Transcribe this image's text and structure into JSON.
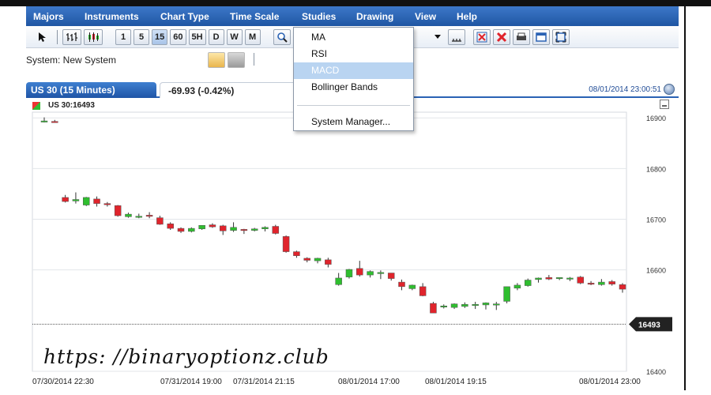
{
  "menu": {
    "items": [
      "Majors",
      "Instruments",
      "Chart Type",
      "Time Scale",
      "Studies",
      "Drawing",
      "View",
      "Help"
    ]
  },
  "toolbar": {
    "intervals": [
      "1",
      "5",
      "15",
      "60",
      "5H",
      "D",
      "W",
      "M"
    ],
    "active_interval": "15"
  },
  "system": {
    "label": "System:  New System"
  },
  "chart_tab": {
    "title": "US 30 (15 Minutes)",
    "change": "-69.93 (-0.42%)",
    "timestamp": "08/01/2014 23:00:51"
  },
  "legend": {
    "label": "US 30:16493"
  },
  "studies_menu": {
    "items": [
      "MA",
      "RSI",
      "MACD",
      "Bollinger Bands"
    ],
    "highlighted": "MACD",
    "footer": "System Manager..."
  },
  "watermark": "https:  //binaryoptionz.club",
  "colors": {
    "bull": "#2fbe2f",
    "bear": "#e0242c",
    "menubar": "#2a62b4",
    "highlight": "#b9d4f1"
  },
  "chart_data": {
    "type": "candlestick",
    "price_labels": [
      "16900",
      "16800",
      "16700",
      "16600",
      "16400"
    ],
    "price_values": [
      16900,
      16800,
      16700,
      16600,
      16400
    ],
    "current_price_label": "16493",
    "current_price": 16493,
    "x_labels": [
      "07/30/2014 22:30",
      "07/31/2014 19:00",
      "07/31/2014 21:15",
      "08/01/2014 17:00",
      "08/01/2014 19:15",
      "08/01/2014 23:00"
    ],
    "ylim": [
      16400,
      16905
    ],
    "candles": [
      {
        "o": 16893,
        "h": 16901,
        "l": 16891,
        "c": 16894
      },
      {
        "o": 16893,
        "h": 16896,
        "l": 16891,
        "c": 16892
      },
      {
        "o": 16743,
        "h": 16748,
        "l": 16733,
        "c": 16735
      },
      {
        "o": 16736,
        "h": 16753,
        "l": 16731,
        "c": 16739
      },
      {
        "o": 16728,
        "h": 16744,
        "l": 16726,
        "c": 16743
      },
      {
        "o": 16740,
        "h": 16745,
        "l": 16725,
        "c": 16731
      },
      {
        "o": 16731,
        "h": 16734,
        "l": 16725,
        "c": 16729
      },
      {
        "o": 16727,
        "h": 16728,
        "l": 16705,
        "c": 16707
      },
      {
        "o": 16705,
        "h": 16713,
        "l": 16703,
        "c": 16710
      },
      {
        "o": 16704,
        "h": 16711,
        "l": 16702,
        "c": 16706
      },
      {
        "o": 16708,
        "h": 16714,
        "l": 16702,
        "c": 16706
      },
      {
        "o": 16703,
        "h": 16707,
        "l": 16689,
        "c": 16690
      },
      {
        "o": 16691,
        "h": 16694,
        "l": 16679,
        "c": 16682
      },
      {
        "o": 16682,
        "h": 16684,
        "l": 16673,
        "c": 16676
      },
      {
        "o": 16676,
        "h": 16684,
        "l": 16674,
        "c": 16682
      },
      {
        "o": 16681,
        "h": 16688,
        "l": 16679,
        "c": 16688
      },
      {
        "o": 16689,
        "h": 16692,
        "l": 16683,
        "c": 16685
      },
      {
        "o": 16687,
        "h": 16689,
        "l": 16669,
        "c": 16677
      },
      {
        "o": 16678,
        "h": 16694,
        "l": 16675,
        "c": 16684
      },
      {
        "o": 16680,
        "h": 16681,
        "l": 16671,
        "c": 16679
      },
      {
        "o": 16678,
        "h": 16683,
        "l": 16676,
        "c": 16681
      },
      {
        "o": 16681,
        "h": 16686,
        "l": 16676,
        "c": 16684
      },
      {
        "o": 16686,
        "h": 16689,
        "l": 16670,
        "c": 16672
      },
      {
        "o": 16666,
        "h": 16668,
        "l": 16634,
        "c": 16636
      },
      {
        "o": 16636,
        "h": 16638,
        "l": 16624,
        "c": 16628
      },
      {
        "o": 16623,
        "h": 16625,
        "l": 16615,
        "c": 16619
      },
      {
        "o": 16618,
        "h": 16624,
        "l": 16613,
        "c": 16623
      },
      {
        "o": 16620,
        "h": 16624,
        "l": 16605,
        "c": 16611
      },
      {
        "o": 16571,
        "h": 16594,
        "l": 16569,
        "c": 16584
      },
      {
        "o": 16586,
        "h": 16602,
        "l": 16583,
        "c": 16601
      },
      {
        "o": 16603,
        "h": 16618,
        "l": 16587,
        "c": 16590
      },
      {
        "o": 16590,
        "h": 16599,
        "l": 16585,
        "c": 16597
      },
      {
        "o": 16595,
        "h": 16599,
        "l": 16582,
        "c": 16595
      },
      {
        "o": 16594,
        "h": 16594,
        "l": 16579,
        "c": 16583
      },
      {
        "o": 16576,
        "h": 16581,
        "l": 16560,
        "c": 16567
      },
      {
        "o": 16563,
        "h": 16571,
        "l": 16560,
        "c": 16570
      },
      {
        "o": 16567,
        "h": 16574,
        "l": 16548,
        "c": 16549
      },
      {
        "o": 16534,
        "h": 16537,
        "l": 16515,
        "c": 16515
      },
      {
        "o": 16528,
        "h": 16532,
        "l": 16524,
        "c": 16529
      },
      {
        "o": 16526,
        "h": 16534,
        "l": 16523,
        "c": 16533
      },
      {
        "o": 16528,
        "h": 16536,
        "l": 16525,
        "c": 16532
      },
      {
        "o": 16531,
        "h": 16537,
        "l": 16523,
        "c": 16532
      },
      {
        "o": 16531,
        "h": 16536,
        "l": 16522,
        "c": 16535
      },
      {
        "o": 16533,
        "h": 16537,
        "l": 16521,
        "c": 16533
      },
      {
        "o": 16538,
        "h": 16567,
        "l": 16534,
        "c": 16567
      },
      {
        "o": 16564,
        "h": 16574,
        "l": 16560,
        "c": 16570
      },
      {
        "o": 16569,
        "h": 16583,
        "l": 16567,
        "c": 16580
      },
      {
        "o": 16581,
        "h": 16585,
        "l": 16575,
        "c": 16584
      },
      {
        "o": 16585,
        "h": 16590,
        "l": 16580,
        "c": 16582
      },
      {
        "o": 16583,
        "h": 16585,
        "l": 16580,
        "c": 16585
      },
      {
        "o": 16584,
        "h": 16586,
        "l": 16578,
        "c": 16584
      },
      {
        "o": 16586,
        "h": 16588,
        "l": 16572,
        "c": 16574
      },
      {
        "o": 16574,
        "h": 16578,
        "l": 16570,
        "c": 16573
      },
      {
        "o": 16571,
        "h": 16582,
        "l": 16569,
        "c": 16576
      },
      {
        "o": 16577,
        "h": 16580,
        "l": 16569,
        "c": 16572
      },
      {
        "o": 16571,
        "h": 16574,
        "l": 16555,
        "c": 16562
      }
    ]
  }
}
